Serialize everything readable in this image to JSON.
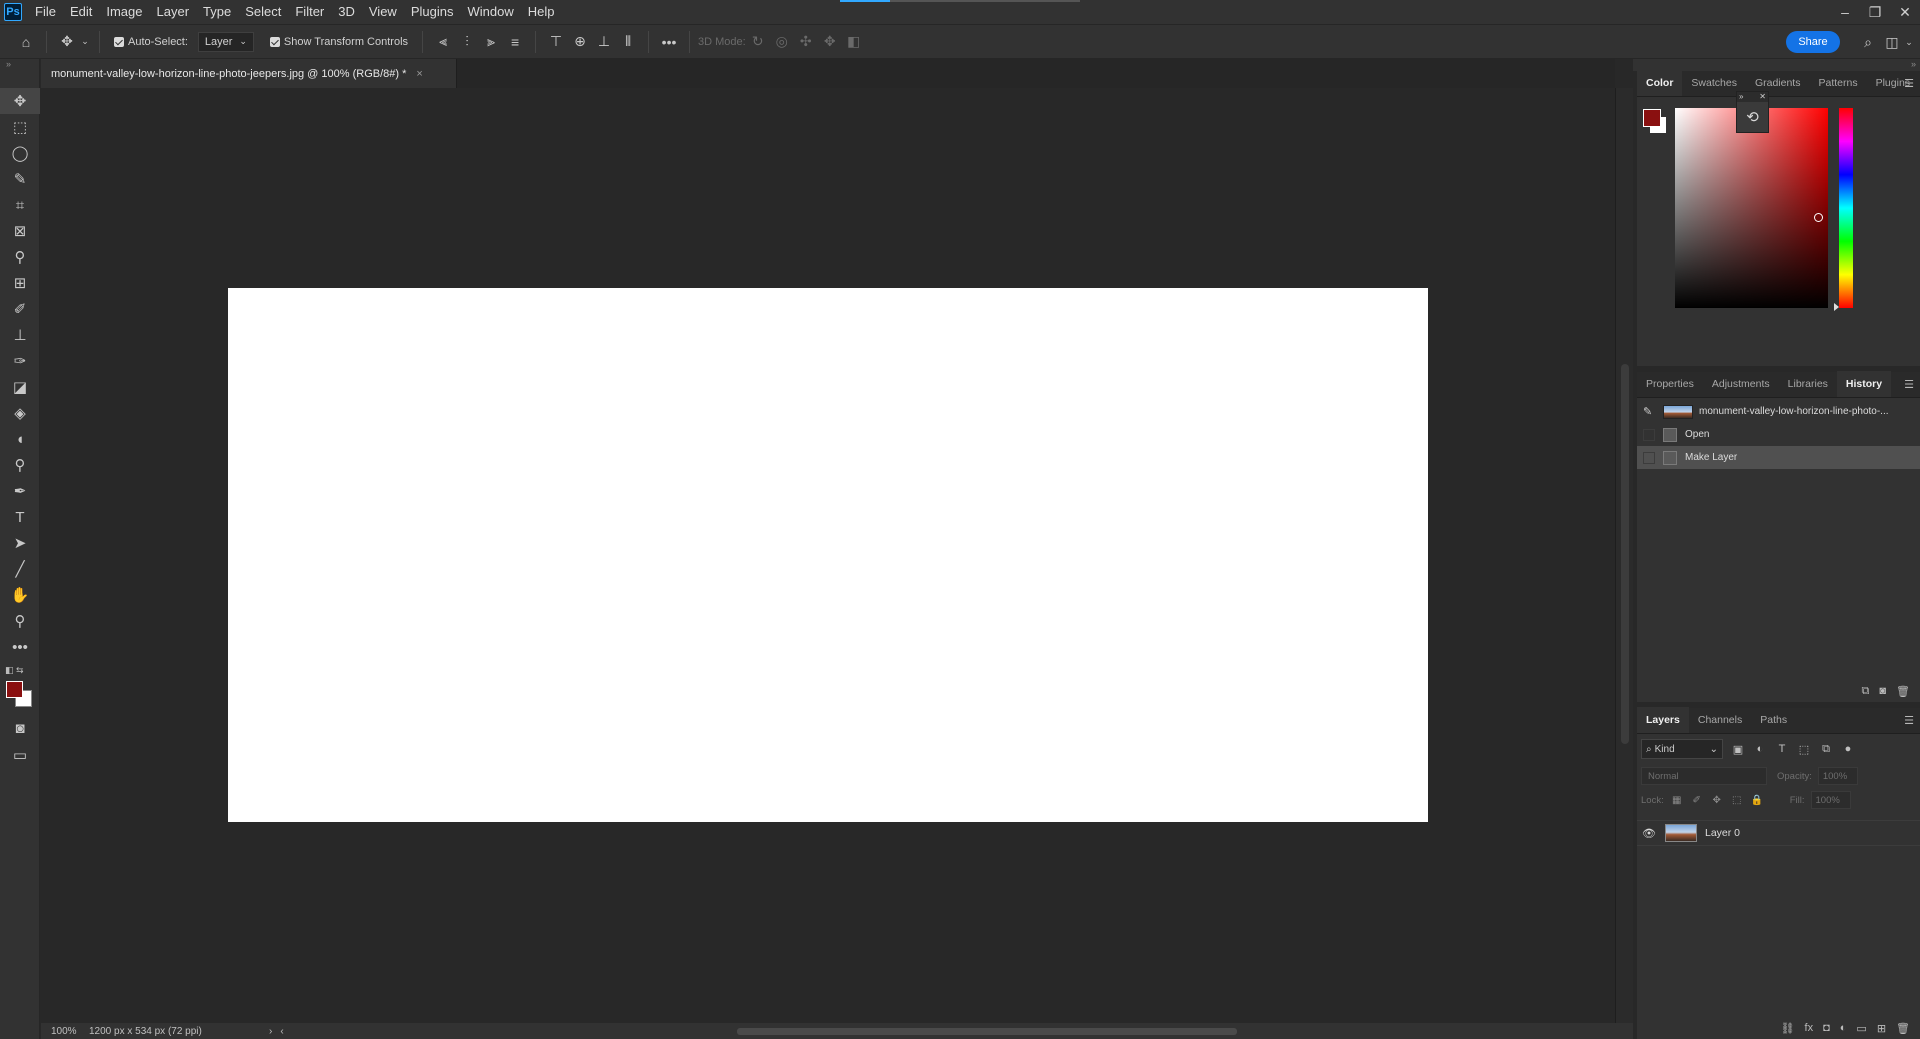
{
  "app": {
    "logo": "Ps",
    "menu": [
      "File",
      "Edit",
      "Image",
      "Layer",
      "Type",
      "Select",
      "Filter",
      "3D",
      "View",
      "Plugins",
      "Window",
      "Help"
    ],
    "window_controls": [
      "–",
      "❐",
      "✕"
    ]
  },
  "options": {
    "auto_select_label": "Auto-Select:",
    "auto_select_value": "Layer",
    "show_transform_label": "Show Transform Controls",
    "mode_3d_label": "3D Mode:",
    "share_label": "Share"
  },
  "document": {
    "tab_title": "monument-valley-low-horizon-line-photo-jeepers.jpg @ 100% (RGB/8#) *",
    "close": "×"
  },
  "status": {
    "zoom": "100%",
    "info": "1200 px x 534 px (72 ppi)"
  },
  "panels": {
    "color_tabs": [
      "Color",
      "Swatches",
      "Gradients",
      "Patterns",
      "Plugins"
    ],
    "mid_tabs": [
      "Properties",
      "Adjustments",
      "Libraries",
      "History"
    ],
    "history": {
      "snapshot": "monument-valley-low-horizon-line-photo-...",
      "steps": [
        "Open",
        "Make Layer"
      ]
    },
    "layer_tabs": [
      "Layers",
      "Channels",
      "Paths"
    ],
    "layers": {
      "kind": "Kind",
      "blend_mode": "Normal",
      "opacity_label": "Opacity:",
      "opacity_value": "100%",
      "lock_label": "Lock:",
      "fill_label": "Fill:",
      "fill_value": "100%",
      "items": [
        {
          "name": "Layer 0"
        }
      ]
    }
  },
  "colors": {
    "foreground": "#8a1010",
    "background": "#ffffff",
    "accent": "#1473e6"
  }
}
